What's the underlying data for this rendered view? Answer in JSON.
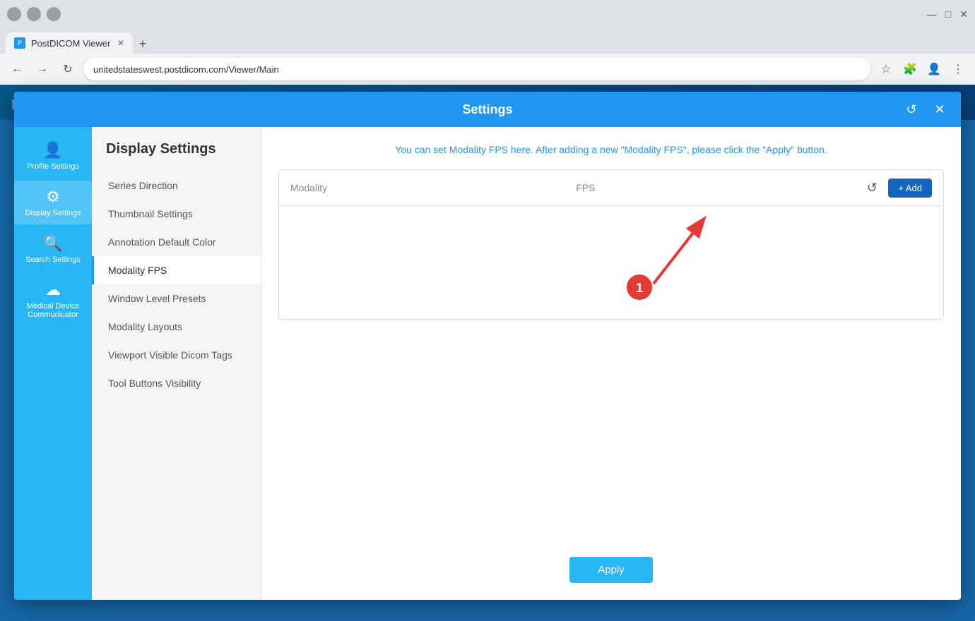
{
  "browser": {
    "tab_title": "PostDICOM Viewer",
    "address": "unitedstateswest.postdicom.com/Viewer/Main",
    "new_tab_symbol": "+",
    "back_symbol": "←",
    "forward_symbol": "→",
    "reload_symbol": "↻",
    "win_minimize": "—",
    "win_maximize": "□",
    "win_close": "✕"
  },
  "modal": {
    "title": "Settings",
    "reset_icon": "↺",
    "close_icon": "✕"
  },
  "sidebar": {
    "items": [
      {
        "id": "profile-settings",
        "label": "Profile Settings",
        "icon": "👤"
      },
      {
        "id": "display-settings",
        "label": "Display Settings",
        "icon": "⚙"
      },
      {
        "id": "search-settings",
        "label": "Search Settings",
        "icon": "🔍"
      },
      {
        "id": "medical-device",
        "label": "Medical Device Communicator",
        "icon": "☁"
      }
    ]
  },
  "nav": {
    "title": "Display Settings",
    "items": [
      {
        "id": "series-direction",
        "label": "Series Direction"
      },
      {
        "id": "thumbnail-settings",
        "label": "Thumbnail Settings"
      },
      {
        "id": "annotation-default-color",
        "label": "Annotation Default Color"
      },
      {
        "id": "modality-fps",
        "label": "Modality FPS",
        "active": true
      },
      {
        "id": "window-level-presets",
        "label": "Window Level Presets"
      },
      {
        "id": "modality-layouts",
        "label": "Modality Layouts"
      },
      {
        "id": "viewport-visible-dicom-tags",
        "label": "Viewport Visible Dicom Tags"
      },
      {
        "id": "tool-buttons-visibility",
        "label": "Tool Buttons Visibility"
      }
    ]
  },
  "main": {
    "info_text": "You can set Modality FPS here. After adding a new \"Modality FPS\", please click the \"Apply\" button.",
    "table": {
      "col_modality": "Modality",
      "col_fps": "FPS",
      "reset_title": "Reset",
      "add_label": "+ Add",
      "add_plus": "+"
    },
    "annotation": {
      "badge_number": "1"
    },
    "apply_label": "Apply"
  }
}
